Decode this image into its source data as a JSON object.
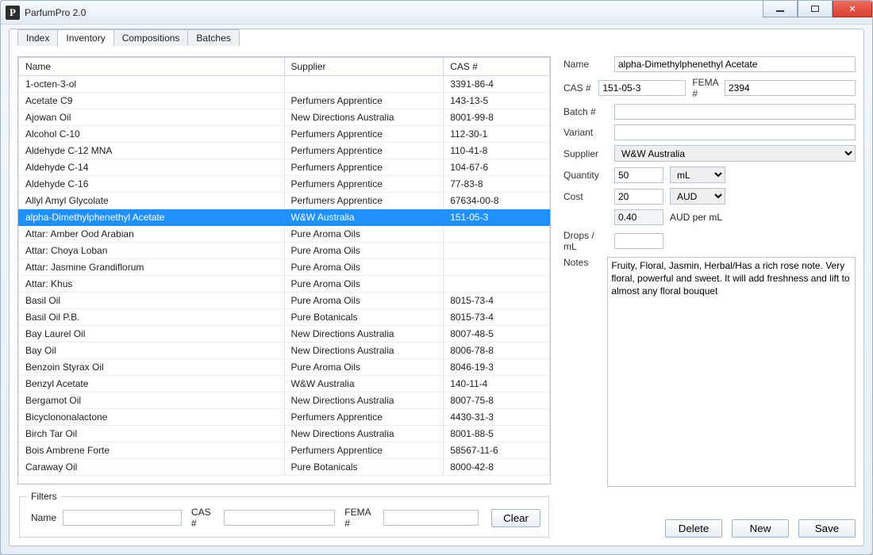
{
  "app": {
    "title": "ParfumPro 2.0",
    "icon_letter": "P"
  },
  "tabs": [
    "Index",
    "Inventory",
    "Compositions",
    "Batches"
  ],
  "active_tab": "Inventory",
  "table": {
    "columns": [
      "Name",
      "Supplier",
      "CAS #"
    ],
    "selected_index": 8,
    "rows": [
      {
        "name": "1-octen-3-ol",
        "supplier": "",
        "cas": "3391-86-4"
      },
      {
        "name": "Acetate C9",
        "supplier": "Perfumers Apprentice",
        "cas": "143-13-5"
      },
      {
        "name": "Ajowan Oil",
        "supplier": "New Directions Australia",
        "cas": "8001-99-8"
      },
      {
        "name": "Alcohol C-10",
        "supplier": "Perfumers Apprentice",
        "cas": "112-30-1"
      },
      {
        "name": "Aldehyde C-12 MNA",
        "supplier": "Perfumers Apprentice",
        "cas": "110-41-8"
      },
      {
        "name": "Aldehyde C-14",
        "supplier": "Perfumers Apprentice",
        "cas": "104-67-6"
      },
      {
        "name": "Aldehyde C-16",
        "supplier": "Perfumers Apprentice",
        "cas": "77-83-8"
      },
      {
        "name": "Allyl Amyl Glycolate",
        "supplier": "Perfumers Apprentice",
        "cas": "67634-00-8"
      },
      {
        "name": "alpha-Dimethylphenethyl Acetate",
        "supplier": "W&W Australia",
        "cas": "151-05-3"
      },
      {
        "name": "Attar: Amber Ood Arabian",
        "supplier": "Pure Aroma Oils",
        "cas": ""
      },
      {
        "name": "Attar: Choya Loban",
        "supplier": "Pure Aroma Oils",
        "cas": ""
      },
      {
        "name": "Attar: Jasmine Grandiflorum",
        "supplier": "Pure Aroma Oils",
        "cas": ""
      },
      {
        "name": "Attar: Khus",
        "supplier": "Pure Aroma Oils",
        "cas": ""
      },
      {
        "name": "Basil Oil",
        "supplier": "Pure Aroma Oils",
        "cas": "8015-73-4"
      },
      {
        "name": "Basil Oil P.B.",
        "supplier": "Pure Botanicals",
        "cas": "8015-73-4"
      },
      {
        "name": "Bay Laurel Oil",
        "supplier": "New Directions Australia",
        "cas": "8007-48-5"
      },
      {
        "name": "Bay Oil",
        "supplier": "New Directions Australia",
        "cas": "8006-78-8"
      },
      {
        "name": "Benzoin Styrax Oil",
        "supplier": "Pure Aroma Oils",
        "cas": "8046-19-3"
      },
      {
        "name": "Benzyl Acetate",
        "supplier": "W&W Australia",
        "cas": "140-11-4"
      },
      {
        "name": "Bergamot Oil",
        "supplier": "New Directions Australia",
        "cas": "8007-75-8"
      },
      {
        "name": "Bicyclononalactone",
        "supplier": "Perfumers Apprentice",
        "cas": "4430-31-3"
      },
      {
        "name": "Birch Tar Oil",
        "supplier": "New Directions Australia",
        "cas": "8001-88-5"
      },
      {
        "name": "Bois Ambrene Forte",
        "supplier": "Perfumers Apprentice",
        "cas": "58567-11-6"
      },
      {
        "name": "Caraway Oil",
        "supplier": "Pure Botanicals",
        "cas": "8000-42-8"
      }
    ]
  },
  "filters": {
    "legend": "Filters",
    "name_label": "Name",
    "name_value": "",
    "cas_label": "CAS #",
    "cas_value": "",
    "fema_label": "FEMA #",
    "fema_value": "",
    "clear_label": "Clear"
  },
  "detail": {
    "labels": {
      "name": "Name",
      "cas": "CAS #",
      "fema": "FEMA #",
      "batch": "Batch #",
      "variant": "Variant",
      "supplier": "Supplier",
      "quantity": "Quantity",
      "cost": "Cost",
      "per": "AUD per mL",
      "drops": "Drops / mL",
      "notes": "Notes"
    },
    "values": {
      "name": "alpha-Dimethylphenethyl Acetate",
      "cas": "151-05-3",
      "fema": "2394",
      "batch": "",
      "variant": "",
      "supplier": "W&W Australia",
      "quantity": "50",
      "quantity_unit": "mL",
      "cost": "20",
      "cost_currency": "AUD",
      "unit_price": "0.40",
      "drops": "",
      "notes": "Fruity, Floral, Jasmin, Herbal/Has a rich rose note. Very floral, powerful and sweet. It will add freshness and lift to almost any floral bouquet"
    }
  },
  "actions": {
    "delete": "Delete",
    "new": "New",
    "save": "Save"
  }
}
